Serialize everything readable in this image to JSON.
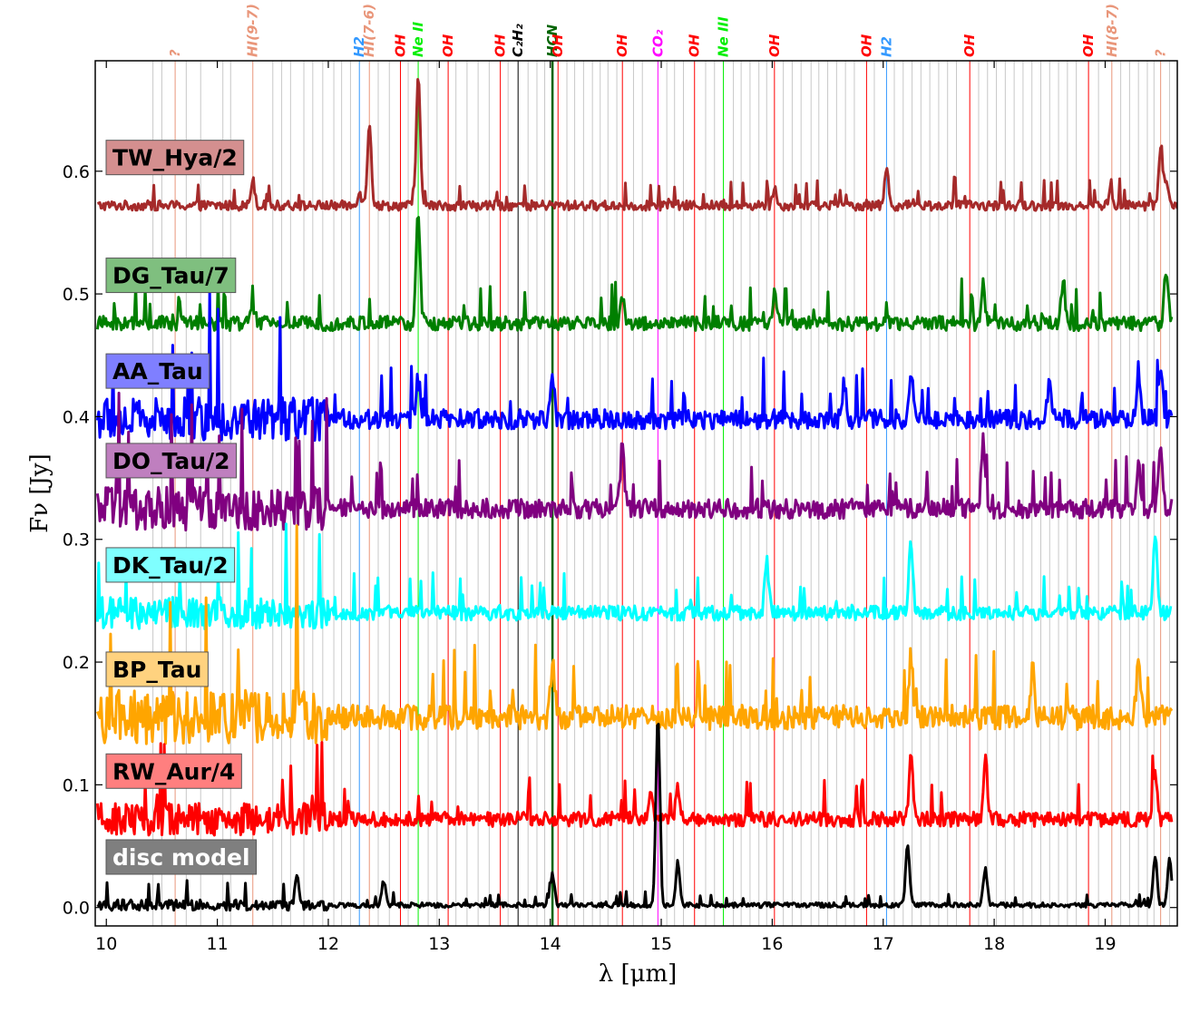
{
  "chart_data": {
    "type": "line",
    "xlabel": "λ [μm]",
    "ylabel": "Fν [Jy]",
    "xlim": [
      9.9,
      19.65
    ],
    "ylim": [
      -0.015,
      0.69
    ],
    "x_ticks": [
      10,
      11,
      12,
      13,
      14,
      15,
      16,
      17,
      18,
      19
    ],
    "y_ticks": [
      0.0,
      0.1,
      0.2,
      0.3,
      0.4,
      0.5,
      0.6
    ],
    "y_tick_labels": [
      "0.0",
      "0.1",
      "0.2",
      "0.3",
      "0.4",
      "0.5",
      "0.6"
    ],
    "grid": false,
    "series": [
      {
        "name": "TW_Hya/2",
        "color": "#a52a2a",
        "box_color": "#d48f8f",
        "text_color": "#000000",
        "baseline": 0.572,
        "noise": 0.004,
        "features": [
          [
            11.32,
            0.022
          ],
          [
            12.28,
            0.012
          ],
          [
            12.37,
            0.068
          ],
          [
            12.81,
            0.108
          ],
          [
            16.02,
            0.012
          ],
          [
            17.03,
            0.03
          ],
          [
            19.05,
            0.012
          ],
          [
            19.5,
            0.05
          ],
          [
            19.55,
            0.02
          ]
        ],
        "x_start": 9.92,
        "x_end": 19.65
      },
      {
        "name": "DG_Tau/7",
        "color": "#007f00",
        "box_color": "#7fbf7f",
        "text_color": "#000000",
        "baseline": 0.476,
        "noise": 0.006,
        "features": [
          [
            11.32,
            0.015
          ],
          [
            12.81,
            0.088
          ],
          [
            14.65,
            0.022
          ],
          [
            16.02,
            0.024
          ],
          [
            17.9,
            0.03
          ],
          [
            18.62,
            0.03
          ],
          [
            19.55,
            0.045
          ]
        ],
        "x_start": 9.92,
        "x_end": 19.6
      },
      {
        "name": "AA_Tau",
        "color": "#0000ff",
        "box_color": "#7f7fff",
        "text_color": "#000000",
        "baseline": 0.398,
        "noise": 0.008,
        "features": [
          [
            12.81,
            0.032
          ],
          [
            14.02,
            0.03
          ],
          [
            16.65,
            0.03
          ],
          [
            17.25,
            0.04
          ],
          [
            18.5,
            0.035
          ],
          [
            19.3,
            0.04
          ],
          [
            19.5,
            0.035
          ]
        ],
        "x_start": 9.92,
        "x_end": 19.6
      },
      {
        "name": "DO_Tau/2",
        "color": "#800080",
        "box_color": "#bf7fbf",
        "text_color": "#000000",
        "baseline": 0.325,
        "noise": 0.008,
        "features": [
          [
            14.65,
            0.055
          ],
          [
            17.9,
            0.055
          ],
          [
            19.3,
            0.04
          ],
          [
            19.5,
            0.045
          ]
        ],
        "x_start": 9.92,
        "x_end": 19.6
      },
      {
        "name": "DK_Tau/2",
        "color": "#00ffff",
        "box_color": "#7fffff",
        "text_color": "#000000",
        "baseline": 0.24,
        "noise": 0.006,
        "features": [
          [
            15.95,
            0.045
          ],
          [
            17.25,
            0.06
          ],
          [
            19.45,
            0.065
          ]
        ],
        "x_start": 9.92,
        "x_end": 19.6
      },
      {
        "name": "BP_Tau",
        "color": "#ffa500",
        "box_color": "#ffd27f",
        "text_color": "#000000",
        "baseline": 0.155,
        "noise": 0.01,
        "features": [
          [
            11.72,
            0.02
          ],
          [
            14.02,
            0.045
          ],
          [
            17.25,
            0.05
          ],
          [
            18.35,
            0.04
          ],
          [
            19.3,
            0.05
          ]
        ],
        "x_start": 9.92,
        "x_end": 19.6
      },
      {
        "name": "RW_Aur/4",
        "color": "#ff0000",
        "box_color": "#ff7f7f",
        "text_color": "#000000",
        "baseline": 0.072,
        "noise": 0.006,
        "features": [
          [
            14.9,
            0.02
          ],
          [
            15.15,
            0.025
          ],
          [
            17.25,
            0.05
          ],
          [
            17.92,
            0.05
          ],
          [
            19.45,
            0.04
          ]
        ],
        "x_start": 9.92,
        "x_end": 19.6
      },
      {
        "name": "disc model",
        "color": "#000000",
        "box_color": "#7f7f7f",
        "text_color": "#ffffff",
        "baseline": 0.002,
        "noise": 0.002,
        "features": [
          [
            11.72,
            0.025
          ],
          [
            12.5,
            0.02
          ],
          [
            14.02,
            0.025
          ],
          [
            14.97,
            0.155
          ],
          [
            15.15,
            0.035
          ],
          [
            17.22,
            0.05
          ],
          [
            17.92,
            0.03
          ],
          [
            19.45,
            0.04
          ],
          [
            19.58,
            0.038
          ]
        ],
        "x_start": 9.92,
        "x_end": 19.6
      }
    ],
    "line_ids": [
      {
        "label": "?",
        "x": 10.62,
        "color": "#e9967a"
      },
      {
        "label": "HI(9-7)",
        "x": 11.32,
        "color": "#e9967a"
      },
      {
        "label": "H2",
        "x": 12.28,
        "color": "#3399ff"
      },
      {
        "label": "HI(7-6)",
        "x": 12.37,
        "color": "#e9967a"
      },
      {
        "label": "OH",
        "x": 12.65,
        "color": "#ff0000"
      },
      {
        "label": "Ne II",
        "x": 12.81,
        "color": "#00ee00"
      },
      {
        "label": "OH",
        "x": 13.08,
        "color": "#ff0000"
      },
      {
        "label": "OH",
        "x": 13.55,
        "color": "#ff0000"
      },
      {
        "label": "C₂H₂",
        "x": 13.71,
        "color": "#000000"
      },
      {
        "label": "HCN",
        "x": 14.02,
        "color": "#006400"
      },
      {
        "label": "OH",
        "x": 14.07,
        "color": "#ff0000"
      },
      {
        "label": "OH",
        "x": 14.65,
        "color": "#ff0000"
      },
      {
        "label": "CO₂",
        "x": 14.97,
        "color": "#ff00ff"
      },
      {
        "label": "OH",
        "x": 15.3,
        "color": "#ff0000"
      },
      {
        "label": "Ne III",
        "x": 15.56,
        "color": "#00ee00"
      },
      {
        "label": "OH",
        "x": 16.02,
        "color": "#ff0000"
      },
      {
        "label": "OH",
        "x": 16.85,
        "color": "#ff0000"
      },
      {
        "label": "H2",
        "x": 17.03,
        "color": "#3399ff"
      },
      {
        "label": "OH",
        "x": 17.78,
        "color": "#ff0000"
      },
      {
        "label": "OH",
        "x": 18.85,
        "color": "#ff0000"
      },
      {
        "label": "HI(8-7)",
        "x": 19.06,
        "color": "#e9967a"
      },
      {
        "label": "?",
        "x": 19.5,
        "color": "#e9967a"
      }
    ],
    "gray_lines": [
      10.42,
      10.5,
      10.72,
      10.85,
      11.05,
      11.12,
      11.5,
      11.58,
      11.66,
      11.78,
      11.86,
      11.95,
      12.05,
      12.12,
      12.2,
      12.45,
      12.55,
      12.72,
      12.9,
      12.98,
      13.15,
      13.25,
      13.35,
      13.45,
      13.62,
      13.8,
      13.88,
      13.95,
      14.15,
      14.22,
      14.3,
      14.38,
      14.45,
      14.52,
      14.6,
      14.75,
      14.83,
      15.05,
      15.12,
      15.2,
      15.4,
      15.48,
      15.65,
      15.72,
      15.8,
      15.88,
      15.95,
      16.1,
      16.18,
      16.26,
      16.35,
      16.42,
      16.5,
      16.58,
      16.66,
      16.74,
      16.92,
      17.1,
      17.18,
      17.26,
      17.34,
      17.42,
      17.5,
      17.58,
      17.66,
      17.86,
      17.94,
      18.02,
      18.1,
      18.18,
      18.26,
      18.34,
      18.42,
      18.5,
      18.58,
      18.66,
      18.74,
      18.94,
      19.14,
      19.22,
      19.3,
      19.38,
      19.44,
      19.58
    ]
  }
}
